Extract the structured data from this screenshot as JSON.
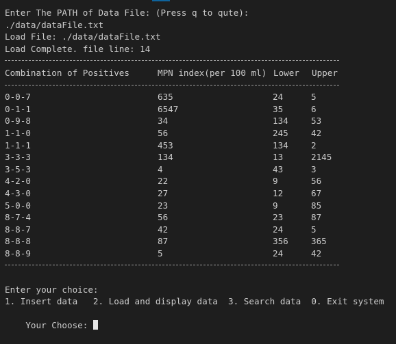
{
  "prompt_path": "Enter The PATH of Data File: (Press q to qute):",
  "entered_path": "./data/dataFile.txt",
  "load_file": "Load File: ./data/dataFile.txt",
  "load_complete": "Load Complete. file line: 14",
  "table": {
    "headers": [
      "Combination of Positives",
      "MPN index(per 100 ml)",
      "Lower",
      "Upper"
    ],
    "rows": [
      [
        "0-0-7",
        "635",
        "24",
        "5"
      ],
      [
        "0-1-1",
        "6547",
        "35",
        "6"
      ],
      [
        "0-9-8",
        "34",
        "134",
        "53"
      ],
      [
        "1-1-0",
        "56",
        "245",
        "42"
      ],
      [
        "1-1-1",
        "453",
        "134",
        "2"
      ],
      [
        "3-3-3",
        "134",
        "13",
        "2145"
      ],
      [
        "3-5-3",
        "4",
        "43",
        "3"
      ],
      [
        "4-2-0",
        "22",
        "9",
        "56"
      ],
      [
        "4-3-0",
        "27",
        "12",
        "67"
      ],
      [
        "5-0-0",
        "23",
        "9",
        "85"
      ],
      [
        "8-7-4",
        "56",
        "23",
        "87"
      ],
      [
        "8-8-7",
        "42",
        "24",
        "5"
      ],
      [
        "8-8-8",
        "87",
        "356",
        "365"
      ],
      [
        "8-8-9",
        "5",
        "24",
        "42"
      ]
    ]
  },
  "menu_title": "Enter your choice:",
  "menu_options": "1. Insert data   2. Load and display data  3. Search data  0. Exit system",
  "input_prompt": "Your Choose: "
}
